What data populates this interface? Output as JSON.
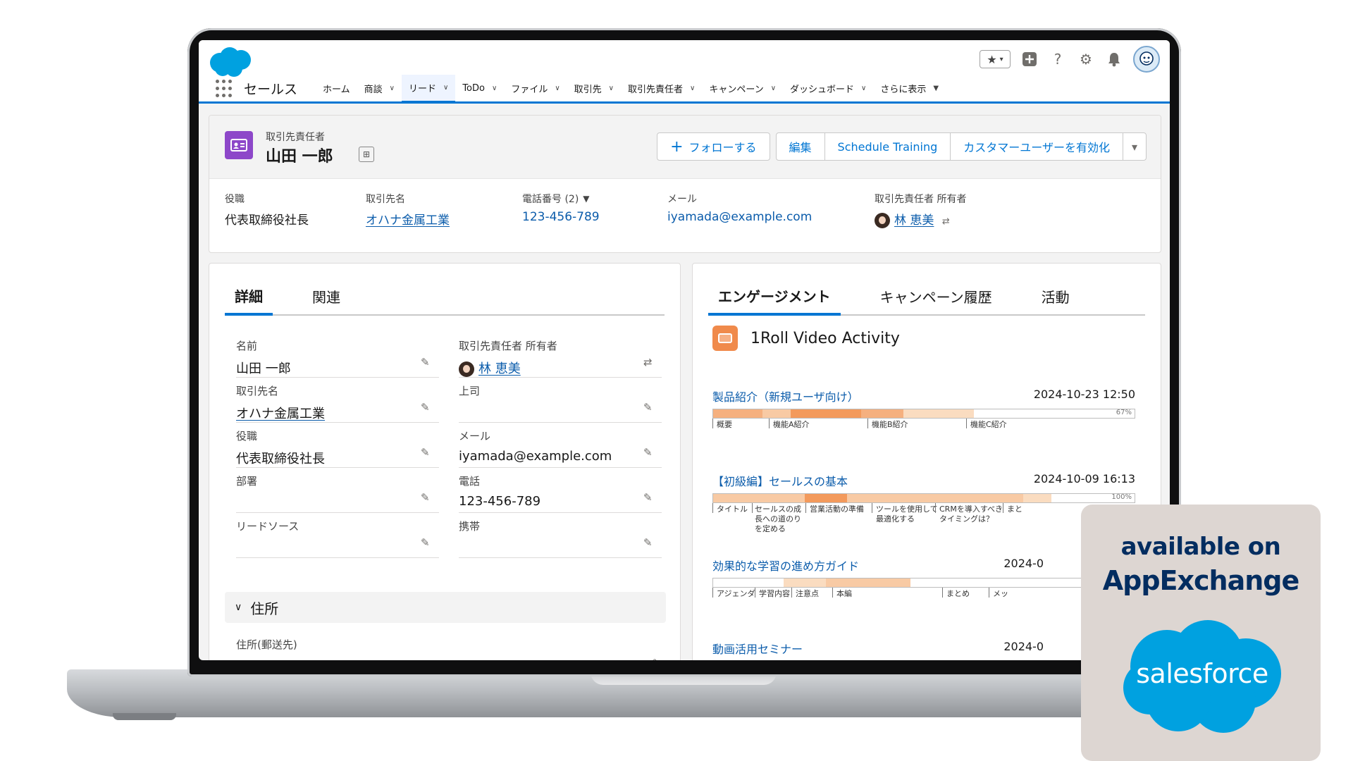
{
  "header": {
    "app_name": "セールス",
    "nav": [
      {
        "label": "ホーム",
        "chevron": false
      },
      {
        "label": "商談",
        "chevron": true
      },
      {
        "label": "リード",
        "chevron": true,
        "active": true
      },
      {
        "label": "ToDo",
        "chevron": true
      },
      {
        "label": "ファイル",
        "chevron": true
      },
      {
        "label": "取引先",
        "chevron": true
      },
      {
        "label": "取引先責任者",
        "chevron": true
      },
      {
        "label": "キャンペーン",
        "chevron": true
      },
      {
        "label": "ダッシュボード",
        "chevron": true
      },
      {
        "label": "さらに表示",
        "chevron": true
      }
    ],
    "icons": [
      "star-icon",
      "add-icon",
      "help-icon",
      "gear-icon",
      "bell-icon",
      "avatar"
    ]
  },
  "record": {
    "type": "取引先責任者",
    "name": "山田 一郎",
    "buttons": {
      "follow": "フォローする",
      "edit": "編集",
      "schedule": "Schedule Training",
      "enable_customer": "カスタマーユーザーを有効化"
    },
    "highlights": {
      "title_label": "役職",
      "title_value": "代表取締役社長",
      "account_label": "取引先名",
      "account_value": "オハナ金属工業",
      "phone_label": "電話番号 (2)",
      "phone_value": "123-456-789",
      "email_label": "メール",
      "email_value": "iyamada@example.com",
      "owner_label": "取引先責任者 所有者",
      "owner_value": "林 恵美"
    }
  },
  "left_panel": {
    "tabs": [
      "詳細",
      "関連"
    ],
    "fields": {
      "name_label": "名前",
      "name_value": "山田 一郎",
      "owner_label": "取引先責任者 所有者",
      "owner_value": "林 恵美",
      "account_label": "取引先名",
      "account_value": "オハナ金属工業",
      "boss_label": "上司",
      "title_label": "役職",
      "title_value": "代表取締役社長",
      "email_label": "メール",
      "email_value": "iyamada@example.com",
      "dept_label": "部署",
      "phone_label": "電話",
      "phone_value": "123-456-789",
      "lead_label": "リードソース",
      "mobile_label": "携帯"
    },
    "address_section": "住所",
    "address_label": "住所(郵送先)"
  },
  "right_panel": {
    "tabs": [
      "エンゲージメント",
      "キャンペーン履歴",
      "活動"
    ],
    "title": "1Roll Video Activity",
    "videos": [
      {
        "title": "製品紹介（新規ユーザ向け）",
        "date": "2024-10-23  12:50",
        "progress": "67%",
        "chapters": [
          "概要",
          "機能A紹介",
          "機能B紹介",
          "機能C紹介"
        ]
      },
      {
        "title": "【初級編】セールスの基本",
        "date": "2024-10-09  16:13",
        "progress": "100%",
        "chapters": [
          "タイトル",
          "セールスの成長への道のりを定める",
          "営業活動の準備",
          "ツールを使用して最適化する",
          "CRMを導入すべきタイミングは？",
          "まと"
        ]
      },
      {
        "title": "効果的な学習の進め方ガイド",
        "date": "2024-0",
        "chapters": [
          "アジェンダ",
          "学習内容",
          "注意点",
          "本編",
          "まとめ",
          "メッ"
        ]
      },
      {
        "title": "動画活用セミナー",
        "date": "2024-0"
      }
    ]
  },
  "badge": {
    "line1": "available on",
    "line2": "AppExchange",
    "brand": "salesforce"
  },
  "colors": {
    "brand_blue": "#0176d3",
    "link_blue": "#0b5cab",
    "contact_purple": "#8d47c9",
    "video_orange": "#f08a4b",
    "badge_bg": "#ddd6d2",
    "badge_text": "#032d60",
    "cloud_blue": "#00a1e0"
  }
}
